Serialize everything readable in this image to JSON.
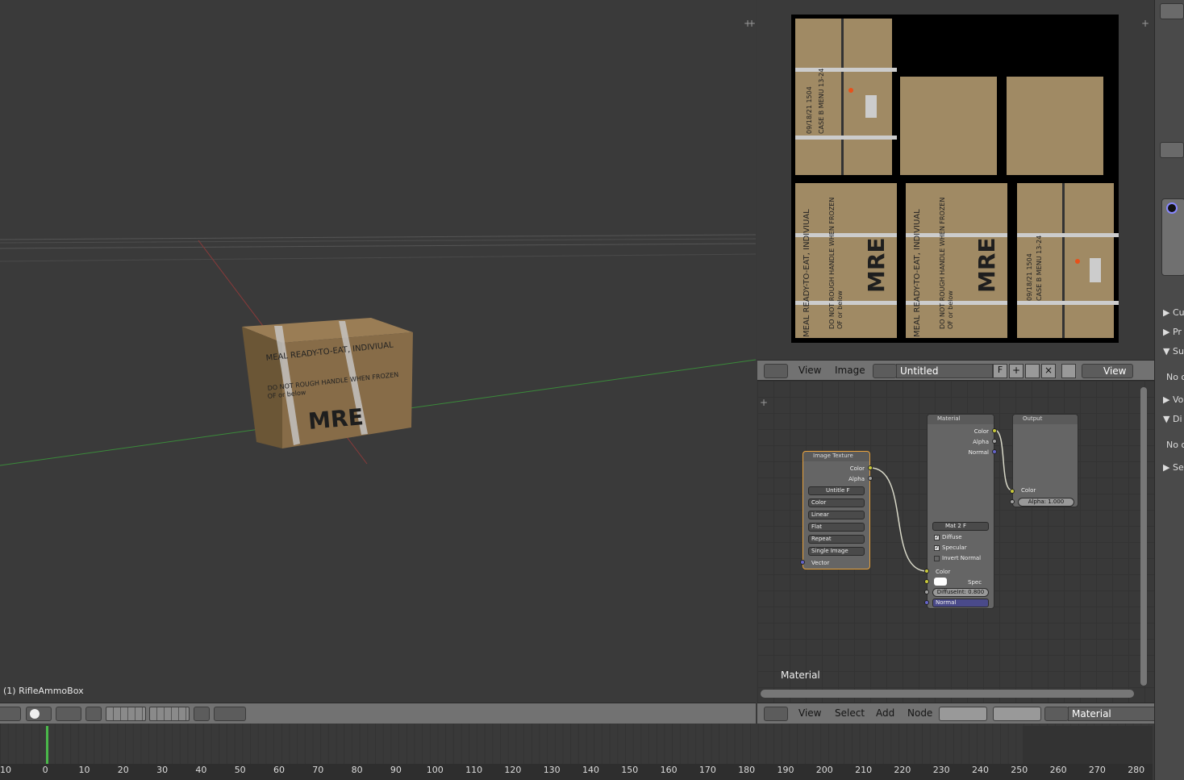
{
  "viewport": {
    "object_label": "(1) RifleAmmoBox",
    "box_text": {
      "line1": "MEAL READY-TO-EAT, INDIVIUAL",
      "line2": "DO NOT ROUGH HANDLE WHEN FROZEN",
      "line3": "OF or below",
      "big": "MRE"
    }
  },
  "image_editor": {
    "menu_view": "View",
    "menu_image": "Image",
    "image_name": "Untitled",
    "fake_user": "F",
    "view_right": "View",
    "texture_text": {
      "case_line": "CASE B MENU 13-24",
      "date_line": "09/18/21 1504",
      "meal_line": "MEAL READY-TO-EAT, INDIVIUAL",
      "rough_line": "DO NOT ROUGH HANDLE WHEN FROZEN",
      "below_line": "OF or below",
      "big": "MRE"
    }
  },
  "node_editor": {
    "tree_label": "Material",
    "menu_view": "View",
    "menu_select": "Select",
    "menu_add": "Add",
    "menu_node": "Node",
    "material_field": "Material",
    "image_texture": {
      "title": "Image Texture",
      "out_color": "Color",
      "out_alpha": "Alpha",
      "image": "Untitle",
      "image_f": "F",
      "color_space": "Color",
      "interpolation": "Linear",
      "projection": "Flat",
      "extension": "Repeat",
      "source": "Single Image",
      "in_vector": "Vector"
    },
    "material": {
      "title": "Material",
      "out_color": "Color",
      "out_alpha": "Alpha",
      "out_normal": "Normal",
      "mat_name": "Mat",
      "mat_users": "2",
      "mat_f": "F",
      "diffuse": "Diffuse",
      "specular": "Specular",
      "invert_normal": "Invert Normal",
      "in_color": "Color",
      "in_spec": "Spec",
      "diffuse_intensity": "DiffuseInt: 0.800",
      "in_normal": "Normal"
    },
    "output": {
      "title": "Output",
      "in_color": "Color",
      "alpha_label": "Alpha:",
      "alpha_value": "1.000"
    }
  },
  "timeline": {
    "ticks": [
      "10",
      "0",
      "10",
      "20",
      "30",
      "40",
      "50",
      "60",
      "70",
      "80",
      "90",
      "100",
      "110",
      "120",
      "130",
      "140",
      "150",
      "160",
      "170",
      "180",
      "190",
      "200",
      "210",
      "220",
      "230",
      "240",
      "250",
      "260",
      "270",
      "280"
    ]
  },
  "properties_panel": {
    "items": [
      "Cu",
      "Pr",
      "Su",
      "No o",
      "Vo",
      "Di",
      "No o",
      "Se"
    ]
  },
  "colors": {
    "box": "#8a6f4b",
    "texture": "#a08a64",
    "node_selected": "#e8a23c",
    "socket_yellow": "#c8c83a",
    "socket_gray": "#a0a0a0",
    "socket_blue": "#6464c8"
  }
}
